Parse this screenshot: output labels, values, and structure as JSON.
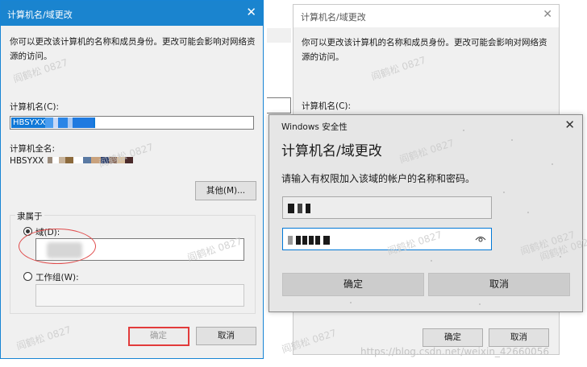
{
  "left_dialog": {
    "title": "计算机名/域更改",
    "description": "你可以更改该计算机的名称和成员身份。更改可能会影响对网络资源的访问。",
    "computer_name_label": "计算机名(C):",
    "computer_name_value": "HBSYXX",
    "full_name_label": "计算机全名:",
    "full_name_value": "HBSYXX",
    "other_button": "其他(M)...",
    "member_group_legend": "隶属于",
    "domain_label": "域(D):",
    "workgroup_label": "工作组(W):",
    "ok_button": "确定",
    "cancel_button": "取消",
    "domain_selected": true
  },
  "right_background_dialog": {
    "title": "计算机名/域更改",
    "description": "你可以更改该计算机的名称和成员身份。更改可能会影响对网络资源的访问。",
    "computer_name_label": "计算机名(C):",
    "ok_button": "确定",
    "cancel_button": "取消"
  },
  "security_dialog": {
    "window_title": "Windows 安全性",
    "heading": "计算机名/域更改",
    "prompt": "请输入有权限加入该域的帐户的名称和密码。",
    "ok_button": "确定",
    "cancel_button": "取消"
  },
  "watermarks": {
    "tag": "阎鹤松 0827",
    "site": "https://blog.csdn.net/weixin_42660056"
  },
  "colors": {
    "title_bar_blue": "#1a84cf",
    "selection_blue": "#0f78d7",
    "highlight_red": "#e23b3b"
  }
}
